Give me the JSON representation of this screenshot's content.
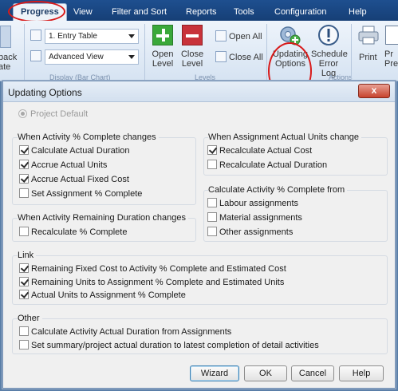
{
  "ribbon": {
    "tabs": [
      "Progress",
      "View",
      "Filter and Sort",
      "Reports",
      "Tools",
      "Configuration",
      "Help"
    ],
    "left_cut": [
      "back",
      "ate"
    ],
    "display_group": {
      "dropdown1": "1. Entry Table",
      "dropdown2": "Advanced View",
      "label": "Display (Bar Chart)"
    },
    "levels_group": {
      "open_level": "Open Level",
      "close_level": "Close Level",
      "open_all": "Open All",
      "close_all": "Close All",
      "label": "Levels"
    },
    "actions": {
      "updating_options": "Updating Options",
      "schedule_error_log": "Schedule Error Log",
      "print": "Print",
      "print_preview_cut": "Pr Pre",
      "label": "Actions"
    }
  },
  "dialog": {
    "title": "Updating Options",
    "close_glyph": "x",
    "project_default": "Project Default",
    "activity_complete": {
      "label": "When Activity % Complete changes",
      "items": [
        {
          "label": "Calculate Actual Duration",
          "checked": true
        },
        {
          "label": "Accrue Actual Units",
          "checked": true
        },
        {
          "label": "Accrue Actual Fixed Cost",
          "checked": true
        },
        {
          "label": "Set Assignment % Complete",
          "checked": false
        }
      ]
    },
    "assignment_units": {
      "label": "When Assignment Actual Units change",
      "items": [
        {
          "label": "Recalculate Actual Cost",
          "checked": true
        },
        {
          "label": "Recalculate Actual Duration",
          "checked": false
        }
      ]
    },
    "calc_from": {
      "label": "Calculate Activity % Complete from",
      "items": [
        {
          "label": "Labour assignments",
          "checked": false
        },
        {
          "label": "Material assignments",
          "checked": false
        },
        {
          "label": "Other assignments",
          "checked": false
        }
      ]
    },
    "remaining_duration": {
      "label": "When Activity Remaining Duration changes",
      "items": [
        {
          "label": "Recalculate % Complete",
          "checked": false
        }
      ]
    },
    "link": {
      "label": "Link",
      "items": [
        {
          "label": "Remaining Fixed Cost to Activity % Complete and Estimated Cost",
          "checked": true
        },
        {
          "label": "Remaining Units to Assignment % Complete and Estimated Units",
          "checked": true
        },
        {
          "label": "Actual Units to Assignment % Complete",
          "checked": true
        }
      ]
    },
    "other": {
      "label": "Other",
      "items": [
        {
          "label": "Calculate Activity Actual Duration from Assignments",
          "checked": false
        },
        {
          "label": "Set summary/project actual duration to latest completion of detail activities",
          "checked": false
        }
      ]
    },
    "buttons": {
      "wizard": "Wizard",
      "ok": "OK",
      "cancel": "Cancel",
      "help": "Help"
    }
  },
  "colors": {
    "menubar": "#1e4f8f",
    "highlight": "#d81a1a",
    "plus_green": "#3aa83a",
    "minus_red": "#c8323a"
  }
}
